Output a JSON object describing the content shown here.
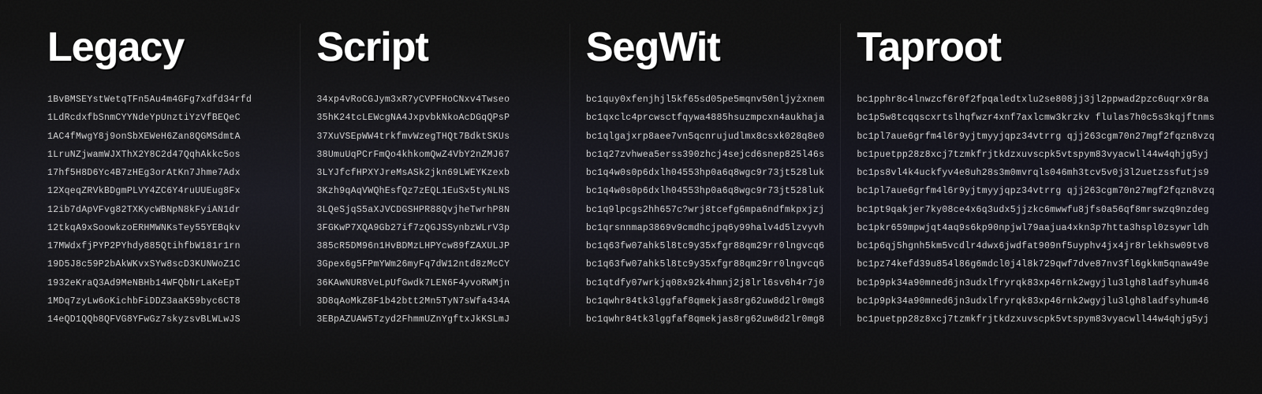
{
  "columns": [
    {
      "id": "legacy",
      "title": "Legacy",
      "addresses": [
        "1BvBMSEYstWetqTFn5Au4m4GFg7xdfd34rfd",
        "1LdRcdxfbSnmCYYNdeYpUnztiYzVfBEQeC",
        "1AC4fMwgY8j9onSbXEWeH6Zan8QGMSdmtA",
        "1LruNZjwamWJXThX2Y8C2d47QqhAkkc5os",
        "17hf5H8D6Yc4B7zHEg3orAtKn7Jhme7Adx",
        "12XqeqZRVkBDgmPLVY4ZC6Y4ruUUEug8Fx",
        "12ib7dApVFvg82TXKycWBNpN8kFyiAN1dr",
        "12tkqA9xSoowkzoERHMWNKsTey55YEBqkv",
        "17MWdxfjPYP2PYhdy885QtihfbW181r1rn",
        "19D5J8c59P2bAkWKvxSYw8scD3KUNWoZ1C",
        "1932eKraQ3Ad9MeNBHb14WFQbNrLaKeEpT",
        "1MDq7zyLw6oKichbFiDDZ3aaK59byc6CT8",
        "14eQD1QQb8QFVG8YFwGz7skyzsvBLWLwJS"
      ]
    },
    {
      "id": "script",
      "title": "Script",
      "addresses": [
        "34xp4vRoCGJym3xR7yCVPFHoCNxv4Twseo",
        "35hK24tcLEWcgNA4JxpvbkNkoAcDGqQPsP",
        "37XuVSEpWW4trkfmvWzegTHQt7BdktSKUs",
        "38UmuUqPCrFmQo4khkomQwZ4VbY2nZMJ67",
        "3LYJfcfHPXYJreMsASk2jkn69LWEYKzexb",
        "3Kzh9qAqVWQhEsfQz7zEQL1EuSx5tyNLNS",
        "3LQeSjqS5aXJVCDGSHPR88QvjheTwrhP8N",
        "3FGKwP7XQA9Gb27if7zQGJSSynbzWLrV3p",
        "385cR5DM96n1HvBDMzLHPYcw89fZAXULJP",
        "3Gpex6g5FPmYWm26myFq7dW12ntd8zMcCY",
        "36KAwNUR8VeLpUfGwdk7LEN6F4yvoRWMjn",
        "3D8qAoMkZ8F1b42btt2Mn5TyN7sWfa434A",
        "3EBpAZUAW5Tzyd2FhmmUZnYgftxJkKSLmJ"
      ]
    },
    {
      "id": "segwit",
      "title": "SegWit",
      "addresses": [
        "bc1quy0xfenjhjl5kf65sd05pe5mqnv50nljyżxnem",
        "bc1qxclc4prcwsctfqywa4885hsuzmpcxn4aukhaja",
        "bc1qlgajxrp8aee7vn5qcnrujudlmx8csxk028q8e0",
        "bc1q27zvhwea5erss390zhcj4sejcd6snep825l46s",
        "bc1q4w0s0p6dxlh04553hp0a6q8wgc9r73jt528luk",
        "bc1q4w0s0p6dxlh04553hp0a6q8wgc9r73jt528luk",
        "bc1q9lpcgs2hh657c?wrj8tcefg6mpa6ndfmkpxjzj",
        "bc1qrsnnmap3869v9cmdhcjpq6y99halv4d5lzvyvh",
        "bc1q63fw07ahk5l8tc9y35xfgr88qm29rr0lngvcq6",
        "bc1q63fw07ahk5l8tc9y35xfgr88qm29rr0lngvcq6",
        "bc1qtdfy07wrkjq08x92k4hmnj2j8lrl6sv6h4r7j0",
        "bc1qwhr84tk3lggfaf8qmekjas8rg62uw8d2lr0mg8",
        "bc1qwhr84tk3lggfaf8qmekjas8rg62uw8d2lr0mg8"
      ]
    },
    {
      "id": "taproot",
      "title": "Taproot",
      "addresses": [
        "bc1pphr8c4lnwzcf6r0f2fpqaledtxlu2se808jj3jl2ppwad2pzc6uqrx9r8a",
        "bc1p5w8tcqqscxrtslhqfwzr4xnf7axlcmw3krzkv flulas7h0c5s3kqjftnms",
        "bc1pl7aue6grfm4l6r9yjtmyyjqpz34vtrrg qjj263cgm70n27mgf2fqzn8vzq",
        "bc1puetpp28z8xcj7tzmkfrjtkdzxuvscpk5vtspym83vyacwll44w4qhjg5yj",
        "bc1ps8vl4k4uckfyv4e8uh28s3m0mvrqls046mh3tcv5v0j3l2uetzssfutjs9",
        "bc1pl7aue6grfm4l6r9yjtmyyjqpz34vtrrg qjj263cgm70n27mgf2fqzn8vzq",
        "bc1pt9qakjer7ky08ce4x6q3udx5jjzkc6mwwfu8jfs0a56qf8mrswzq9nzdeg",
        "bc1pkr659mpwjqt4aq9s6kp90npjwl79aajua4xkn3p7htta3hspl0zsywrldh",
        "bc1p6qj5hgnh5km5vcdlr4dwx6jwdfat909nf5uyphv4jx4jr8rlekhsw09tv8",
        "bc1pz74kefd39u854l86g6mdcl0j4l8k729qwf7dve87nv3fl6gkkm5qnaw49e",
        "bc1p9pk34a90mned6jn3udxlfryrqk83xp46rnk2wgyjlu3lgh8ladfsyhum46",
        "bc1p9pk34a90mned6jn3udxlfryrqk83xp46rnk2wgyjlu3lgh8ladfsyhum46",
        "bc1puetpp28z8xcj7tzmkfrjtkdzxuvscpk5vtspym83vyacwll44w4qhjg5yj"
      ]
    }
  ]
}
